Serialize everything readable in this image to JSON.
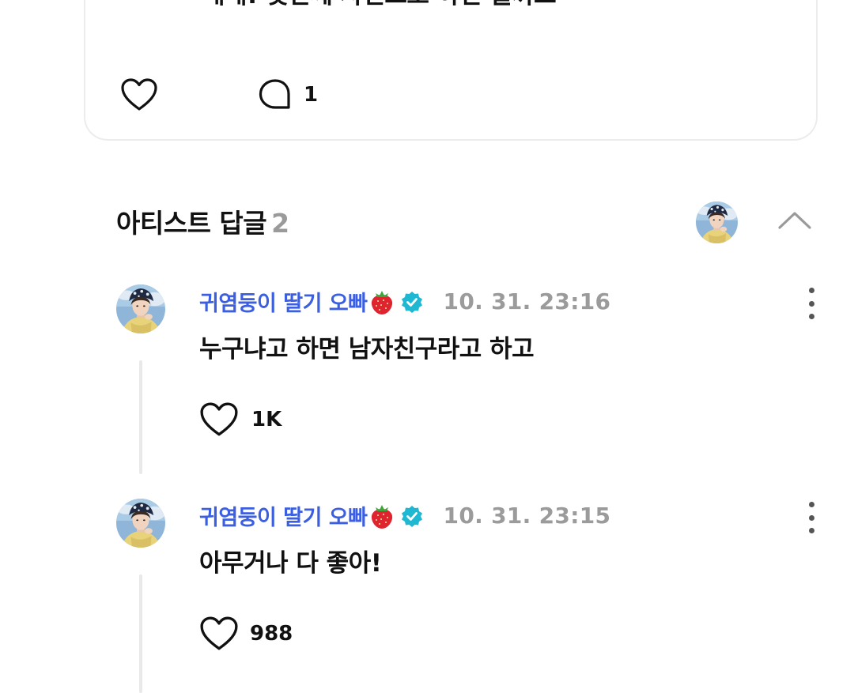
{
  "post": {
    "text": "네네! 몇번째 사진으로 하면 될까요",
    "like_icon": "heart-outline-icon",
    "comment_icon": "speech-bubble-icon",
    "reply_count": "1"
  },
  "artist_replies": {
    "title": "아티스트 답글",
    "count": "2",
    "collapse_icon": "chevron-up-icon"
  },
  "comments": [
    {
      "author": "귀염둥이 딸기 오빠",
      "emoji_icon": "strawberry-icon",
      "verified_icon": "verified-badge-icon",
      "timestamp": "10. 31. 23:16",
      "text": "누구냐고 하면 남자친구라고 하고",
      "likes": "1K"
    },
    {
      "author": "귀염둥이 딸기 오빠",
      "emoji_icon": "strawberry-icon",
      "verified_icon": "verified-badge-icon",
      "timestamp": "10. 31. 23:15",
      "text": "아무거나 다 좋아!",
      "likes": "988"
    }
  ],
  "colors": {
    "author_name": "#3b5fe0",
    "verified_badge": "#1fb8d3",
    "timestamp": "#9b9b9b",
    "count_muted": "#9a9a9a",
    "thread_line": "#e9e9e9"
  }
}
